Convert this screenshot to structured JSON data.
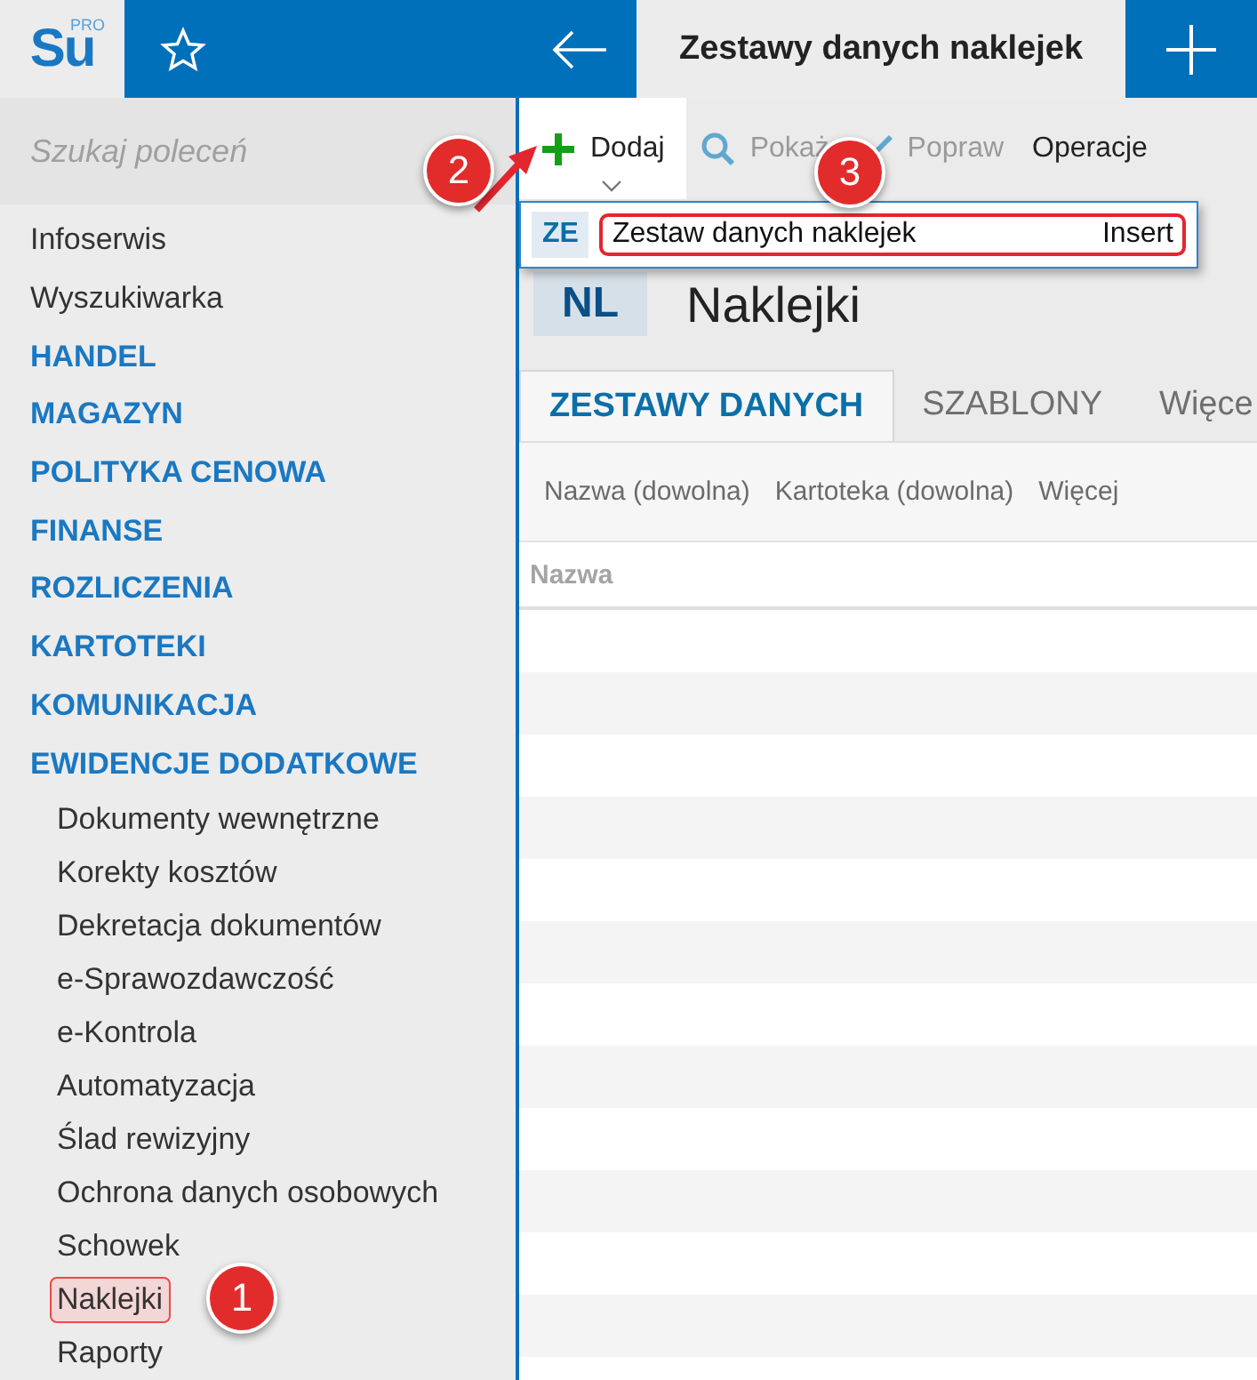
{
  "app": {
    "logo": "Su",
    "logo_badge": "PRO"
  },
  "header": {
    "title": "Zestawy danych naklejek"
  },
  "search": {
    "placeholder": "Szukaj poleceń"
  },
  "menu": [
    {
      "label": "Infoserwis",
      "kind": "link",
      "selected": false
    },
    {
      "label": "Wyszukiwarka",
      "kind": "link",
      "selected": false
    },
    {
      "label": "HANDEL",
      "kind": "section",
      "selected": false
    },
    {
      "label": "MAGAZYN",
      "kind": "section",
      "selected": false
    },
    {
      "label": "POLITYKA CENOWA",
      "kind": "section",
      "selected": false
    },
    {
      "label": "FINANSE",
      "kind": "section",
      "selected": false
    },
    {
      "label": "ROZLICZENIA",
      "kind": "section",
      "selected": false
    },
    {
      "label": "KARTOTEKI",
      "kind": "section",
      "selected": false
    },
    {
      "label": "KOMUNIKACJA",
      "kind": "section",
      "selected": false
    },
    {
      "label": "EWIDENCJE DODATKOWE",
      "kind": "section",
      "selected": false,
      "children": [
        {
          "label": "Dokumenty wewnętrzne",
          "selected": false
        },
        {
          "label": "Korekty kosztów",
          "selected": false
        },
        {
          "label": "Dekretacja dokumentów",
          "selected": false
        },
        {
          "label": "e-Sprawozdawczość",
          "selected": false
        },
        {
          "label": "e-Kontrola",
          "selected": false
        },
        {
          "label": "Automatyzacja",
          "selected": false
        },
        {
          "label": "Ślad rewizyjny",
          "selected": false
        },
        {
          "label": "Ochrona danych osobowych",
          "selected": false
        },
        {
          "label": "Schowek",
          "selected": false
        },
        {
          "label": "Naklejki",
          "selected": true
        },
        {
          "label": "Raporty",
          "selected": false
        }
      ]
    }
  ],
  "toolbar": [
    {
      "label": "Dodaj",
      "kind": "add",
      "active": true,
      "disabled": false
    },
    {
      "label": "Pokaż",
      "kind": "show",
      "active": false,
      "disabled": true
    },
    {
      "label": "Popraw",
      "kind": "edit",
      "active": false,
      "disabled": true
    },
    {
      "label": "Operacje",
      "kind": "menu",
      "active": false,
      "disabled": false
    }
  ],
  "dropdown": {
    "badge": "ZE",
    "label": "Zestaw danych naklejek",
    "shortcut": "Insert"
  },
  "page": {
    "badge": "NL",
    "title": "Naklejki"
  },
  "tabs": [
    {
      "label": "ZESTAWY DANYCH",
      "selected": true
    },
    {
      "label": "SZABLONY",
      "selected": false
    },
    {
      "label": "Więce",
      "selected": false
    }
  ],
  "filters": [
    "Nazwa (dowolna)",
    "Kartoteka (dowolna)",
    "Więcej"
  ],
  "table": {
    "columns": [
      "Nazwa"
    ]
  },
  "annotations": [
    {
      "number": "1"
    },
    {
      "number": "2"
    },
    {
      "number": "3"
    }
  ]
}
